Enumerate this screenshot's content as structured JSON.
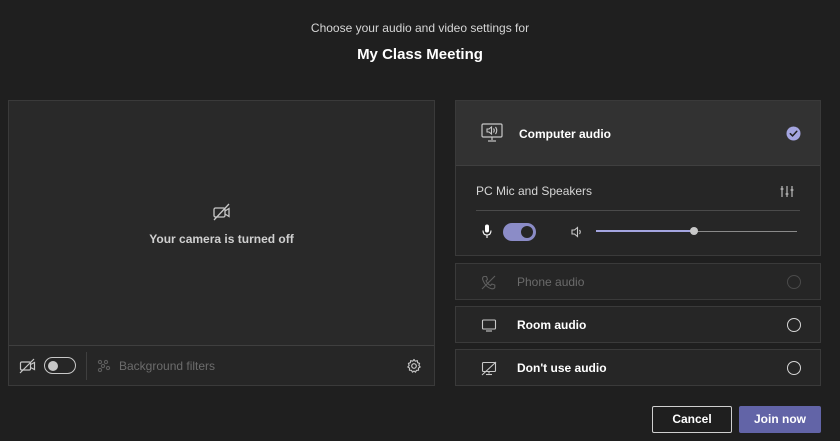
{
  "header": {
    "subtitle": "Choose your audio and video settings for",
    "meeting_title": "My Class Meeting"
  },
  "camera": {
    "status_text": "Your camera is turned off",
    "camera_toggle_on": false,
    "background_filters_label": "Background filters",
    "icons": [
      "camera-off-icon",
      "background-filters-icon",
      "settings-gear-icon"
    ]
  },
  "audio": {
    "computer_audio": {
      "label": "Computer audio",
      "selected": true
    },
    "device_label": "PC Mic and Speakers",
    "mic_toggle_on": true,
    "speaker_volume": 0.49,
    "options": [
      {
        "label": "Phone audio",
        "disabled": true,
        "selected": false
      },
      {
        "label": "Room audio",
        "disabled": false,
        "selected": false
      },
      {
        "label": "Don't use audio",
        "disabled": false,
        "selected": false
      }
    ]
  },
  "actions": {
    "cancel_label": "Cancel",
    "join_label": "Join now"
  },
  "colors": {
    "background": "#1f1f1f",
    "panel": "#292929",
    "accent": "#6264a7",
    "accent_light": "#8b8cc7"
  }
}
